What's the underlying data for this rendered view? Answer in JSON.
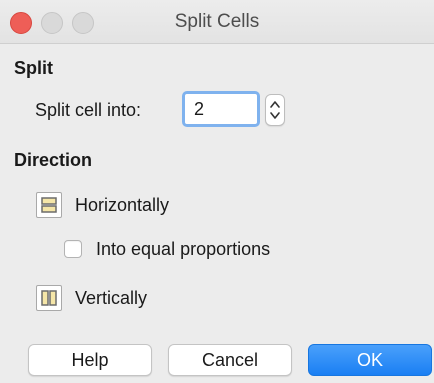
{
  "window": {
    "title": "Split Cells"
  },
  "split": {
    "heading": "Split",
    "label": "Split cell into:",
    "value": "2"
  },
  "direction": {
    "heading": "Direction",
    "horizontal_label": "Horizontally",
    "equal_proportions_label": "Into equal proportions",
    "equal_proportions_checked": false,
    "vertical_label": "Vertically"
  },
  "buttons": {
    "help": "Help",
    "cancel": "Cancel",
    "ok": "OK"
  },
  "colors": {
    "close_button": "#ee5e57",
    "accent": "#1a7ff3",
    "focus_ring": "#7fb2ee",
    "direction_icon_fill": "#f5e6a8",
    "direction_icon_stroke": "#6b6b6b"
  },
  "icons": {
    "horizontal": "split-horizontal-icon",
    "vertical": "split-vertical-icon",
    "stepper": "stepper-icon"
  }
}
